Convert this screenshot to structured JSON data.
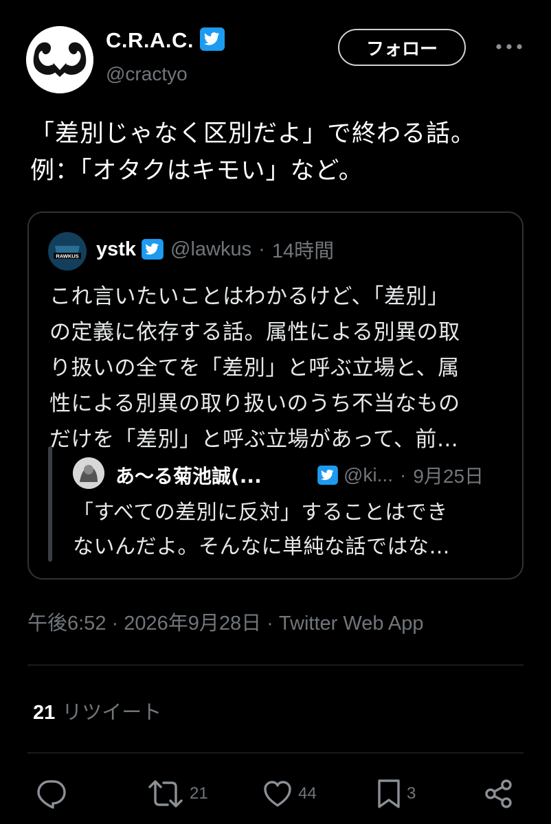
{
  "author": {
    "display_name": "C.R.A.C.",
    "handle": "@cractyo",
    "verified_icon": "verified-badge-icon",
    "follow_label": "フォロー"
  },
  "tweet": {
    "text": "「差別じゃなく区別だよ」で終わる話。\n例：「オタクはキモい」など。"
  },
  "quote": {
    "name": "ystk",
    "handle": "@lawkus",
    "separator": "·",
    "time": "14時間",
    "avatar_text": "RAWKUS",
    "text": "これ言いたいことはわかるけど、「差別」\nの定義に依存する話。属性による別異の取\nり扱いの全てを「差別」と呼ぶ立場と、属\n性による別異の取り扱いのうち不当なもの\nだけを「差別」と呼ぶ立場があって、前…",
    "nested": {
      "name": "あ〜る菊池誠(...",
      "handle": "@ki...",
      "separator": "·",
      "date": "9月25日",
      "text": "「すべての差別に反対」することはでき\nないんだよ。そんなに単純な話ではな…"
    }
  },
  "meta": {
    "line": "午後6:52 · 2026年9月28日 · Twitter Web App"
  },
  "stats": {
    "retweets_count": "21",
    "retweets_label": "リツイート"
  },
  "actions": {
    "reply_icon": "reply-icon",
    "retweet_count": "21",
    "like_count": "44",
    "bookmark_count": "3",
    "share_icon": "share-icon"
  },
  "colors": {
    "background": "#000000",
    "verified": "#1d9bf0",
    "secondary_text": "#71767b",
    "border": "#2f3336"
  }
}
